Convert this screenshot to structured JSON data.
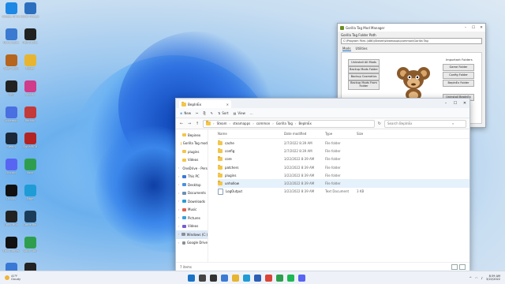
{
  "desktop": {
    "icons": [
      {
        "label": "Google Drive",
        "icon": "google-drive-icon",
        "color": "#1e88e5"
      },
      {
        "label": "Quick Access",
        "icon": "computer-icon",
        "color": "#2c6fbf"
      },
      {
        "label": "Documents",
        "icon": "documents-icon",
        "color": "#3b7ad0"
      },
      {
        "label": "OBS Studio",
        "icon": "obs-icon",
        "color": "#222222"
      },
      {
        "label": "Total Audio",
        "icon": "audio-icon",
        "color": "#b5651d"
      },
      {
        "label": "Folder",
        "icon": "folder-icon",
        "color": "#e8b530"
      },
      {
        "label": "OBS",
        "icon": "obs-icon",
        "color": "#222222"
      },
      {
        "label": "Spotify",
        "icon": "spotify-icon",
        "color": "#d03b8a"
      },
      {
        "label": "Voicemod",
        "icon": "voicemod-icon",
        "color": "#4a6fe0"
      },
      {
        "label": "Backup",
        "icon": "backup-icon",
        "color": "#c23a3a"
      },
      {
        "label": "Steam",
        "icon": "steam-icon",
        "color": "#1b2838"
      },
      {
        "label": "SignalRGB",
        "icon": "signalrgb-icon",
        "color": "#b42323"
      },
      {
        "label": "Discord",
        "icon": "discord-icon",
        "color": "#5865f2"
      },
      {
        "label": "Xbox",
        "icon": "xbox-icon",
        "color": "#2e9e4e"
      },
      {
        "label": "Oculus",
        "icon": "oculus-icon",
        "color": "#111111"
      },
      {
        "label": "Edge",
        "icon": "edge-icon",
        "color": "#1f9cd6"
      },
      {
        "label": "Unity Hub",
        "icon": "unity-icon",
        "color": "#222222"
      },
      {
        "label": "Game Bar",
        "icon": "gamebar-icon",
        "color": "#1c3d5a"
      },
      {
        "label": "Epic Games",
        "icon": "epic-games-icon",
        "color": "#111111"
      },
      {
        "label": "Xbox App",
        "icon": "xbox-icon",
        "color": "#2e9e4e"
      },
      {
        "label": "Launcher",
        "icon": "launcher-icon",
        "color": "#3a78d6"
      },
      {
        "label": "GitHub",
        "icon": "github-icon",
        "color": "#222222"
      }
    ]
  },
  "explorer": {
    "tab_title": "BepInEx",
    "toolbar": [
      "New",
      "Sort",
      "View",
      "..."
    ],
    "address": [
      "Steam",
      "steamapps",
      "common",
      "Gorilla Tag",
      "BepInEx"
    ],
    "search_placeholder": "Search BepInEx",
    "nav": [
      {
        "label": "Bepinex",
        "icon": "folder-icon"
      },
      {
        "label": "Gorilla Tag mod",
        "icon": "folder-icon"
      },
      {
        "label": "plugins",
        "icon": "folder-icon"
      },
      {
        "label": "Videos",
        "icon": "folder-icon"
      },
      {
        "label": "OneDrive - Perso",
        "icon": "onedrive-icon"
      },
      {
        "label": "This PC",
        "icon": "pc-icon"
      },
      {
        "label": "Desktop",
        "icon": "desktop-icon"
      },
      {
        "label": "Documents",
        "icon": "documents-icon"
      },
      {
        "label": "Downloads",
        "icon": "downloads-icon"
      },
      {
        "label": "Music",
        "icon": "music-icon"
      },
      {
        "label": "Pictures",
        "icon": "pictures-icon"
      },
      {
        "label": "Videos",
        "icon": "videos-icon"
      },
      {
        "label": "Windows (C:)",
        "icon": "drive-icon"
      },
      {
        "label": "Google Drive",
        "icon": "drive-icon"
      }
    ],
    "columns": [
      "Name",
      "Date modified",
      "Type",
      "Size"
    ],
    "files": [
      {
        "name": "cache",
        "date": "2/7/2022 8:39 AM",
        "type": "File folder",
        "size": "",
        "kind": "folder"
      },
      {
        "name": "config",
        "date": "2/7/2022 8:39 AM",
        "type": "File folder",
        "size": "",
        "kind": "folder"
      },
      {
        "name": "core",
        "date": "3/22/2022 8:39 AM",
        "type": "File folder",
        "size": "",
        "kind": "folder"
      },
      {
        "name": "patchers",
        "date": "3/22/2022 8:39 AM",
        "type": "File folder",
        "size": "",
        "kind": "folder"
      },
      {
        "name": "plugins",
        "date": "3/22/2022 8:39 AM",
        "type": "File folder",
        "size": "",
        "kind": "folder"
      },
      {
        "name": "unhollow",
        "date": "3/22/2022 8:39 AM",
        "type": "File folder",
        "size": "",
        "kind": "folder"
      },
      {
        "name": "LogOutput",
        "date": "3/22/2022 8:39 AM",
        "type": "Text Document",
        "size": "3 KB",
        "kind": "file"
      }
    ],
    "status": "7 items"
  },
  "backup": {
    "title": "Gorilla Tag Mod Manager",
    "folder_label": "Gorilla Tag Folder Path",
    "path": "C:\\Program Files (x86)\\Steam\\steamapps\\common\\Gorilla Tag",
    "tabs": [
      "Mods",
      "Utilities"
    ],
    "left_buttons": [
      "Uninstall All Mods",
      "Backup Mods Folder",
      "Backup Cosmetics",
      "Backup Mods From Folder"
    ],
    "right_label": "Important Folders",
    "right_buttons": [
      "Game Folder",
      "Config Folder",
      "BepInEx Folder",
      "Uninstall BepInEx"
    ]
  },
  "taskbar": {
    "weather_temp": "41°F",
    "weather_desc": "Cloudy",
    "apps": [
      {
        "icon": "windows-start-icon",
        "color": "#1a73c7"
      },
      {
        "icon": "search-icon",
        "color": "#444444"
      },
      {
        "icon": "task-view-icon",
        "color": "#333333"
      },
      {
        "icon": "widgets-icon",
        "color": "#3b7bd4"
      },
      {
        "icon": "file-explorer-icon",
        "color": "#e8b530"
      },
      {
        "icon": "edge-icon",
        "color": "#1f9cd6"
      },
      {
        "icon": "store-icon",
        "color": "#2d5fb5"
      },
      {
        "icon": "chrome-icon",
        "color": "#db4437"
      },
      {
        "icon": "xbox-icon",
        "color": "#2e9e4e"
      },
      {
        "icon": "spotify-icon",
        "color": "#1db954"
      },
      {
        "icon": "discord-icon",
        "color": "#5865f2"
      }
    ],
    "tray": "^",
    "time": "8:39 AM",
    "date": "3/22/2022"
  }
}
